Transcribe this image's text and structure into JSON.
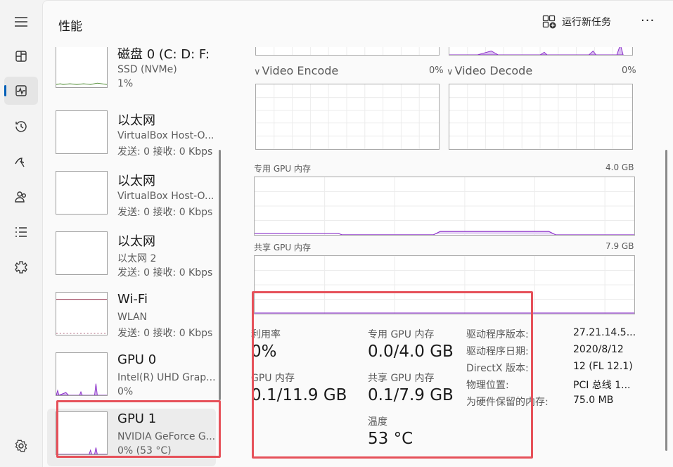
{
  "header": {
    "title": "性能",
    "new_task_label": "运行新任务",
    "more_label": "···"
  },
  "nav": [
    {
      "name": "menu-icon"
    },
    {
      "name": "processes-icon"
    },
    {
      "name": "performance-icon",
      "active": true
    },
    {
      "name": "app-history-icon"
    },
    {
      "name": "startup-apps-icon"
    },
    {
      "name": "users-icon"
    },
    {
      "name": "details-icon"
    },
    {
      "name": "services-icon"
    },
    {
      "name": "settings-icon"
    }
  ],
  "sidebar": {
    "items": [
      {
        "title": "磁盘 0 (C: D: F:",
        "line1": "SSD (NVMe)",
        "line2": "1%"
      },
      {
        "title": "以太网",
        "line1": "VirtualBox Host-O...",
        "line2": "发送: 0 接收: 0 Kbps"
      },
      {
        "title": "以太网",
        "line1": "VirtualBox Host-O...",
        "line2": "发送: 0 接收: 0 Kbps"
      },
      {
        "title": "以太网",
        "line1": "以太网 2",
        "line2": "发送: 0 接收: 0 Kbps"
      },
      {
        "title": "Wi-Fi",
        "line1": "WLAN",
        "line2": "发送: 0 接收: 0 Kbps"
      },
      {
        "title": "GPU 0",
        "line1": "Intel(R) UHD Grap...",
        "line2": "0%"
      },
      {
        "title": "GPU 1",
        "line1": "NVIDIA GeForce G...",
        "line2": "0% (53 °C)"
      }
    ]
  },
  "graphs": {
    "video_encode": {
      "label": "Video Encode",
      "pct": "0%"
    },
    "video_decode": {
      "label": "Video Decode",
      "pct": "0%"
    },
    "dedicated": {
      "label": "专用 GPU 内存",
      "max": "4.0 GB"
    },
    "shared": {
      "label": "共享 GPU 内存",
      "max": "7.9 GB"
    }
  },
  "stats": {
    "util_label": "利用率",
    "util_value": "0%",
    "gpu_mem_label": "GPU 内存",
    "gpu_mem_value": "0.1/11.9 GB",
    "ded_label": "专用 GPU 内存",
    "ded_value": "0.0/4.0 GB",
    "shared_label": "共享 GPU 内存",
    "shared_value": "0.1/7.9 GB",
    "temp_label": "温度",
    "temp_value": "53 °C"
  },
  "info": [
    {
      "label": "驱动程序版本:",
      "value": "27.21.14.5..."
    },
    {
      "label": "驱动程序日期:",
      "value": "2020/8/12"
    },
    {
      "label": "DirectX 版本:",
      "value": "12 (FL 12.1)"
    },
    {
      "label": "物理位置:",
      "value": "PCI 总线 1..."
    },
    {
      "label": "为硬件保留的内存:",
      "value": "75.0 MB"
    }
  ],
  "colors": {
    "gpu_line": "#8b2fc9",
    "wifi_line": "#8a1c3c",
    "disk_line": "#4c8a2f",
    "highlight": "#e6515a",
    "accent": "#005fb8"
  }
}
